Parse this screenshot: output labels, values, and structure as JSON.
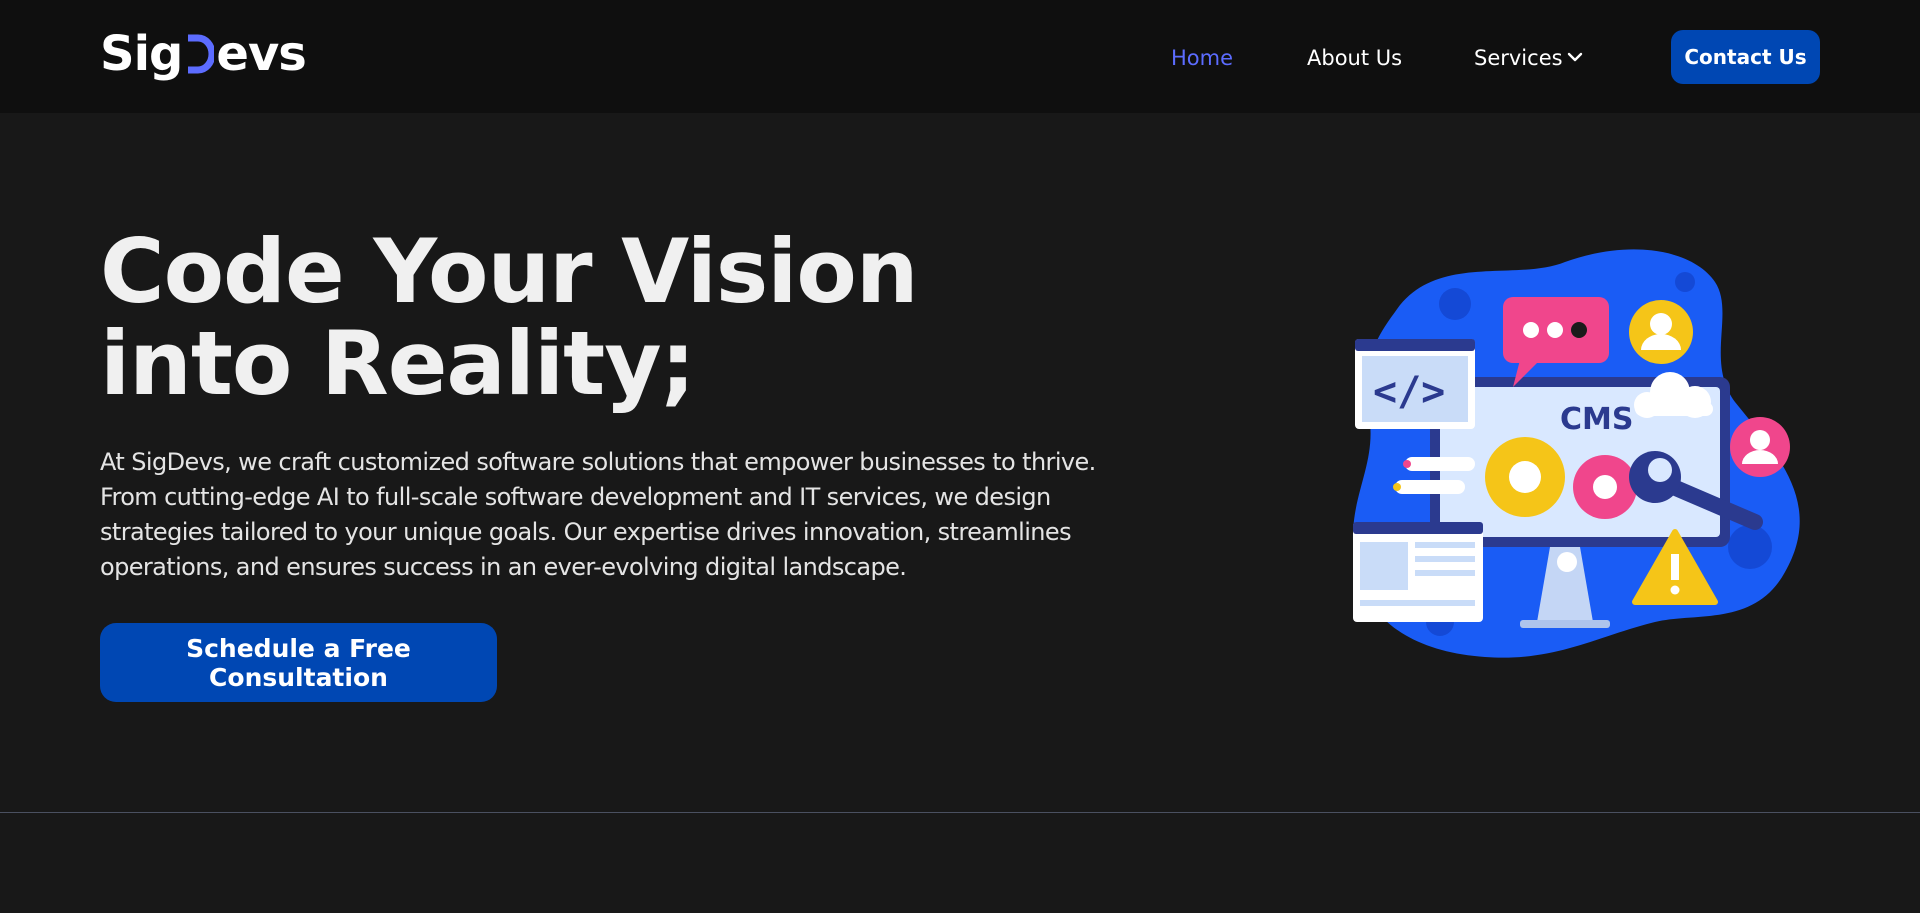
{
  "header": {
    "logo": {
      "prefix": "Sig",
      "suffix": "evs"
    },
    "nav": [
      {
        "label": "Home",
        "active": true
      },
      {
        "label": "About Us",
        "active": false
      },
      {
        "label": "Services",
        "active": false
      }
    ],
    "contact_label": "Contact Us"
  },
  "hero": {
    "title_line1": "Code Your Vision",
    "title_line2": "into Reality;",
    "description": "At SigDevs, we craft customized software solutions that empower businesses to thrive. From cutting-edge AI to full-scale software development and IT services, we design strategies tailored to your unique goals. Our expertise drives innovation, streamlines operations, and ensures success in an ever-evolving digital landscape.",
    "cta_label": "Schedule a Free Consultation"
  },
  "illustration": {
    "code_label": "</>",
    "screen_label": "CMS"
  },
  "colors": {
    "accent": "#5c6cff",
    "button": "#0047b3",
    "background": "#181818",
    "header": "#0f0f0f"
  }
}
